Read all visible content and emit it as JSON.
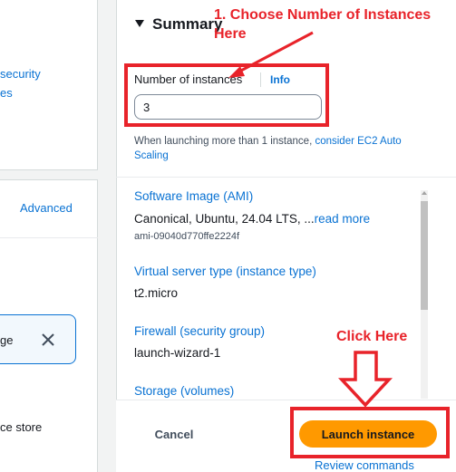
{
  "left": {
    "card1": {
      "line1": "security",
      "line2": "es"
    },
    "card2": {
      "advanced_link": "Advanced",
      "token_text": "ge",
      "token_close_icon": "close-icon",
      "bottom_text": "ce store"
    }
  },
  "summary": {
    "title": "Summary",
    "number_of_instances": {
      "label": "Number of instances",
      "info_label": "Info",
      "value": "3"
    },
    "hint_prefix": "When launching more than 1 instance, ",
    "hint_link": "consider EC2 Auto Scaling",
    "items": [
      {
        "label": "Software Image (AMI)",
        "value_prefix": "Canonical, Ubuntu, 24.04 LTS, ...",
        "value_link": "read more",
        "sub": "ami-09040d770ffe2224f"
      },
      {
        "label": "Virtual server type (instance type)",
        "value": "t2.micro"
      },
      {
        "label": "Firewall (security group)",
        "value": "launch-wizard-1"
      },
      {
        "label": "Storage (volumes)"
      }
    ],
    "footer": {
      "cancel_label": "Cancel",
      "launch_label": "Launch instance",
      "review_label": "Review commands"
    }
  },
  "annotations": {
    "step1_line1": "1. Choose Number of Instances",
    "step1_line2": "Here",
    "click_here": "Click Here",
    "color": "#e8232a"
  },
  "colors": {
    "link": "#0972d3",
    "primary_button": "#ff9900"
  }
}
